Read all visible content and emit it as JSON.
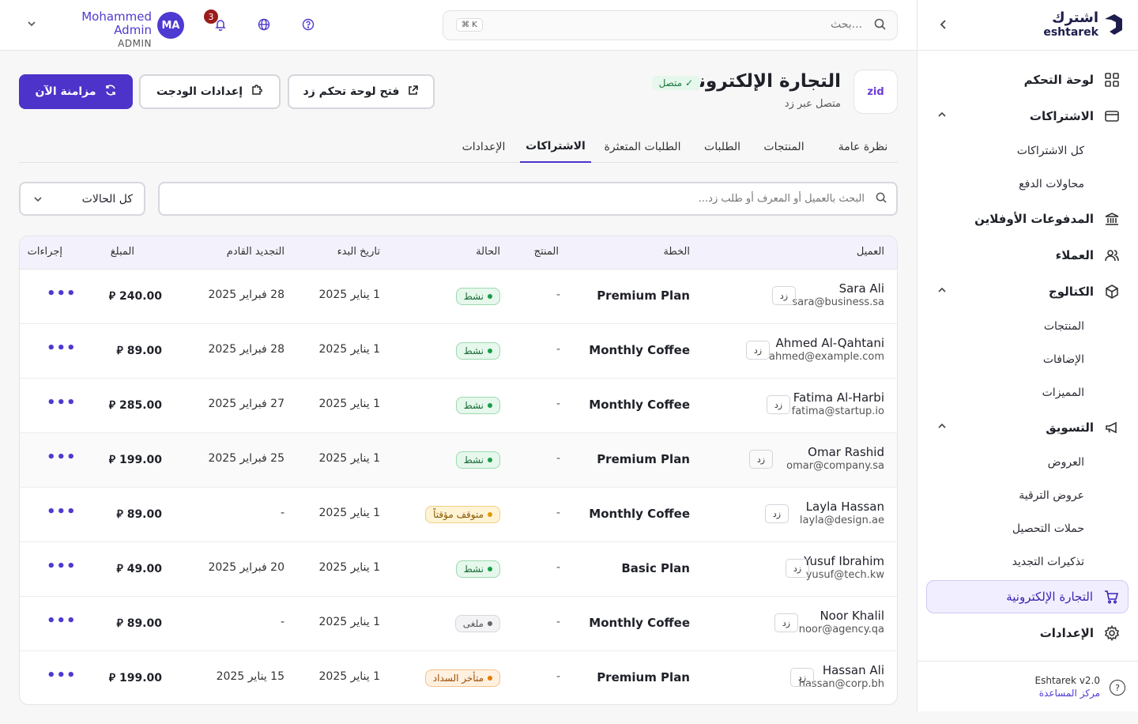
{
  "sidebar": {
    "brand_ar": "اشترك",
    "brand_en": "eshtarek",
    "items": {
      "dashboard": "لوحة التحكم",
      "subscriptions": "الاشتراكات",
      "all_subscriptions": "كل الاشتراكات",
      "payment_attempts": "محاولات الدفع",
      "offline_payments": "المدفوعات الأوفلاين",
      "customers": "العملاء",
      "catalog": "الكتالوج",
      "products": "المنتجات",
      "addons": "الإضافات",
      "features": "المميزات",
      "marketing": "التسويق",
      "offers": "العروض",
      "upgrade_offers": "عروض الترقية",
      "dunning": "حملات التحصيل",
      "renewal_reminders": "تذكيرات التجديد",
      "ecommerce": "التجارة الإلكترونية",
      "settings": "الإعدادات"
    },
    "version": "Eshtarek v2.0",
    "help_center": "مركز المساعدة"
  },
  "topbar": {
    "search_placeholder": "بحث...",
    "shortcut": "⌘ K",
    "notifications_count": "3",
    "user_initials": "MA",
    "user_name": "Mohammed Admin",
    "user_role": "ADMIN"
  },
  "header": {
    "integration_logo": "zid",
    "title": "التجارة الإلكترونية",
    "connected_badge": "متصل",
    "subtitle": "متصل عبر زد",
    "open_dashboard": "فتح لوحة تحكم زد",
    "widget_settings": "إعدادات الودجت",
    "sync_now": "مزامنة الآن"
  },
  "tabs": {
    "overview": "نظرة عامة",
    "products": "المنتجات",
    "orders": "الطلبات",
    "failed_orders": "الطلبات المتعثرة",
    "subscriptions": "الاشتراكات",
    "settings": "الإعدادات"
  },
  "filters": {
    "search_placeholder": "البحث بالعميل أو المعرف أو طلب زد...",
    "status_value": "كل الحالات"
  },
  "table": {
    "headers": {
      "customer": "العميل",
      "plan": "الخطة",
      "product": "المنتج",
      "status": "الحالة",
      "start_date": "تاريخ البدء",
      "next_renewal": "التجديد القادم",
      "amount": "المبلغ",
      "actions": "إجراءات"
    },
    "source_tag": "زد",
    "rows": [
      {
        "name": "Sara Ali",
        "email": "sara@business.sa",
        "plan": "Premium Plan",
        "product": "-",
        "status": "نشط",
        "status_kind": "active",
        "start": "1 يناير 2025",
        "renewal": "28 فبراير 2025",
        "amount": "240.00 ⃁"
      },
      {
        "name": "Ahmed Al-Qahtani",
        "email": "ahmed@example.com",
        "plan": "Monthly Coffee",
        "product": "-",
        "status": "نشط",
        "status_kind": "active",
        "start": "1 يناير 2025",
        "renewal": "28 فبراير 2025",
        "amount": "89.00 ⃁"
      },
      {
        "name": "Fatima Al-Harbi",
        "email": "fatima@startup.io",
        "plan": "Monthly Coffee",
        "product": "-",
        "status": "نشط",
        "status_kind": "active",
        "start": "1 يناير 2025",
        "renewal": "27 فبراير 2025",
        "amount": "285.00 ⃁"
      },
      {
        "name": "Omar Rashid",
        "email": "omar@company.sa",
        "plan": "Premium Plan",
        "product": "-",
        "status": "نشط",
        "status_kind": "active",
        "start": "1 يناير 2025",
        "renewal": "25 فبراير 2025",
        "amount": "199.00 ⃁"
      },
      {
        "name": "Layla Hassan",
        "email": "layla@design.ae",
        "plan": "Monthly Coffee",
        "product": "-",
        "status": "متوقف مؤقتاً",
        "status_kind": "paused",
        "start": "1 يناير 2025",
        "renewal": "-",
        "amount": "89.00 ⃁"
      },
      {
        "name": "Yusuf Ibrahim",
        "email": "yusuf@tech.kw",
        "plan": "Basic Plan",
        "product": "-",
        "status": "نشط",
        "status_kind": "active",
        "start": "1 يناير 2025",
        "renewal": "20 فبراير 2025",
        "amount": "49.00 ⃁"
      },
      {
        "name": "Noor Khalil",
        "email": "noor@agency.qa",
        "plan": "Monthly Coffee",
        "product": "-",
        "status": "ملغى",
        "status_kind": "cancel",
        "start": "1 يناير 2025",
        "renewal": "-",
        "amount": "89.00 ⃁"
      },
      {
        "name": "Hassan Ali",
        "email": "hassan@corp.bh",
        "plan": "Premium Plan",
        "product": "-",
        "status": "متأخر السداد",
        "status_kind": "over",
        "start": "1 يناير 2025",
        "renewal": "15 يناير 2025",
        "amount": "199.00 ⃁"
      }
    ]
  },
  "colors": {
    "accent": "#4d33c9",
    "active_green": "#1a9d4a",
    "paused_amber": "#e09b00",
    "overdue_orange": "#e57b00"
  }
}
